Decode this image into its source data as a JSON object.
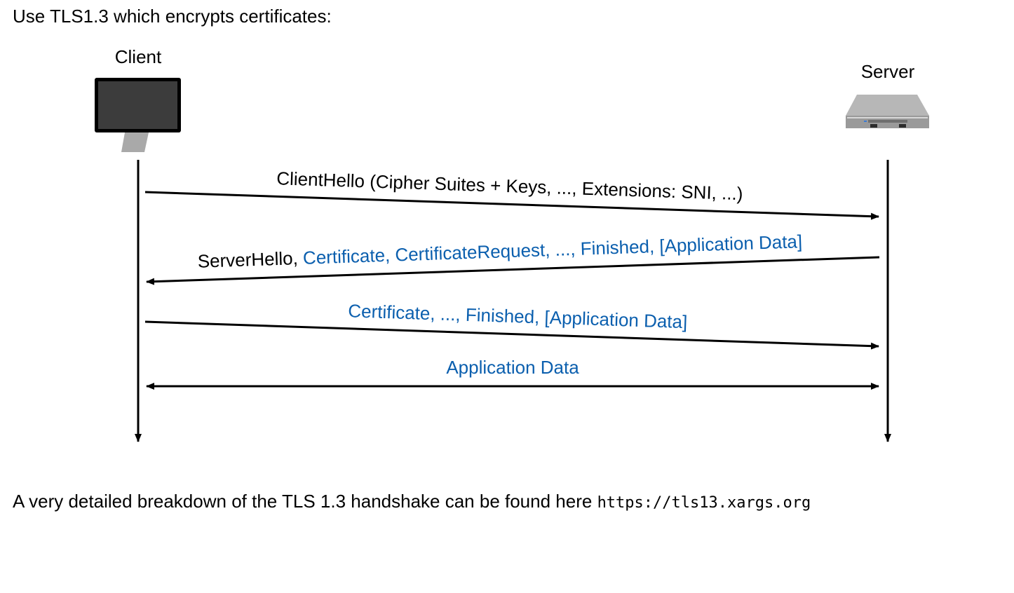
{
  "title": "Use TLS1.3 which encrypts certificates:",
  "client": {
    "label": "Client",
    "icon": "monitor-icon"
  },
  "server": {
    "label": "Server",
    "icon": "rack-server-icon"
  },
  "colors": {
    "black": "#000000",
    "encrypted_blue": "#0b5fae"
  },
  "messages": [
    {
      "id": "client-hello",
      "direction": "client-to-server",
      "plain": "ClientHello (Cipher Suites + Keys, ..., Extensions: SNI, ...)",
      "encrypted": ""
    },
    {
      "id": "server-hello",
      "direction": "server-to-client",
      "plain": "ServerHello, ",
      "encrypted": "Certificate, CertificateRequest, ..., Finished, [Application Data]"
    },
    {
      "id": "client-finished",
      "direction": "client-to-server",
      "plain": "",
      "encrypted": "Certificate, ..., Finished, [Application Data]"
    },
    {
      "id": "application-data",
      "direction": "bidirectional",
      "plain": "",
      "encrypted": "Application Data"
    }
  ],
  "footer": {
    "text": "A very detailed breakdown of the TLS 1.3 handshake can be found here ",
    "url": "https://tls13.xargs.org"
  }
}
